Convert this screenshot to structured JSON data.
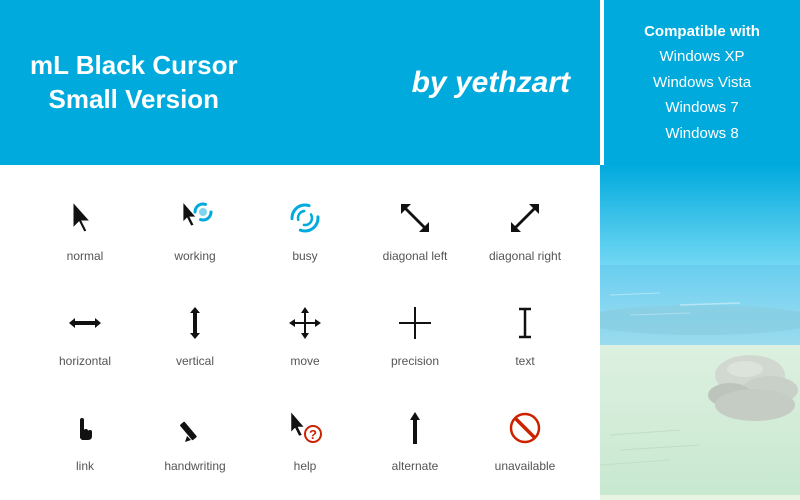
{
  "header": {
    "title_line1": "mL Black Cursor",
    "title_line2": "Small Version",
    "author_prefix": "by ",
    "author_name": "yethzart",
    "compat_label": "Compatible with",
    "compat_items": [
      "Windows XP",
      "Windows Vista",
      "Windows 7",
      "Windows 8"
    ]
  },
  "cursors": {
    "rows": [
      [
        {
          "id": "normal",
          "label": "normal"
        },
        {
          "id": "working",
          "label": "working"
        },
        {
          "id": "busy",
          "label": "busy"
        },
        {
          "id": "diagonal-left",
          "label": "diagonal left"
        },
        {
          "id": "diagonal-right",
          "label": "diagonal right"
        }
      ],
      [
        {
          "id": "horizontal",
          "label": "horizontal"
        },
        {
          "id": "vertical",
          "label": "vertical"
        },
        {
          "id": "move",
          "label": "move"
        },
        {
          "id": "precision",
          "label": "precision"
        },
        {
          "id": "text",
          "label": "text"
        }
      ],
      [
        {
          "id": "link",
          "label": "link"
        },
        {
          "id": "handwriting",
          "label": "handwriting"
        },
        {
          "id": "help",
          "label": "help"
        },
        {
          "id": "alternate",
          "label": "alternate"
        },
        {
          "id": "unavailable",
          "label": "unavailable"
        }
      ]
    ]
  }
}
